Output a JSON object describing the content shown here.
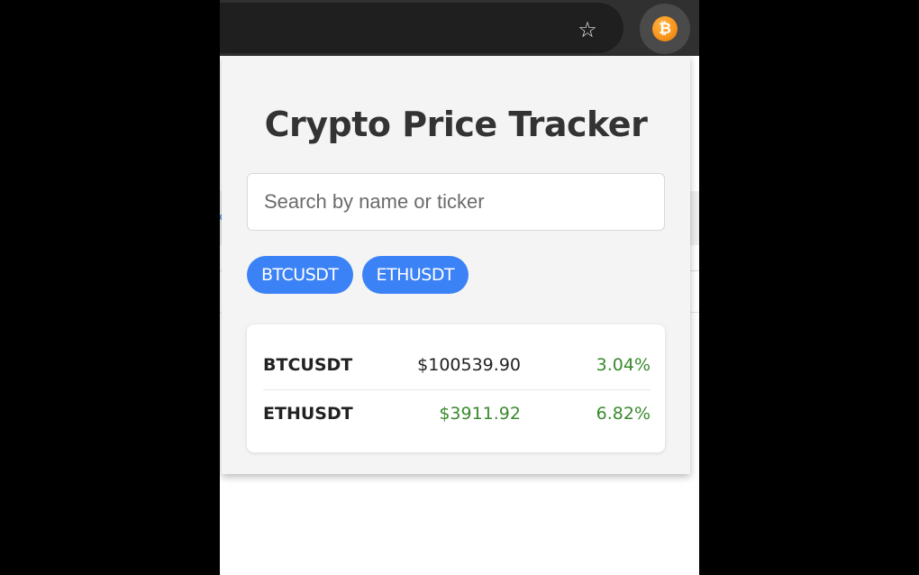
{
  "browser": {
    "toolbar": {
      "bookmark_icon": "star-icon",
      "extension_icon": "bitcoin-icon",
      "extension_glyph": "₿"
    }
  },
  "popup": {
    "title": "Crypto Price Tracker",
    "search": {
      "placeholder": "Search by name or ticker",
      "value": ""
    },
    "chips": [
      {
        "label": "BTCUSDT"
      },
      {
        "label": "ETHUSDT"
      }
    ],
    "prices": [
      {
        "symbol": "BTCUSDT",
        "price": "$100539.90",
        "change": "3.04%",
        "price_color": "#222222",
        "change_color": "#3a8a2e"
      },
      {
        "symbol": "ETHUSDT",
        "price": "$3911.92",
        "change": "6.82%",
        "price_color": "#3a8a2e",
        "change_color": "#3a8a2e"
      }
    ]
  },
  "colors": {
    "accent": "#3b82f6",
    "positive": "#3a8a2e",
    "toolbar": "#303030",
    "popup_bg": "#f4f4f4"
  }
}
